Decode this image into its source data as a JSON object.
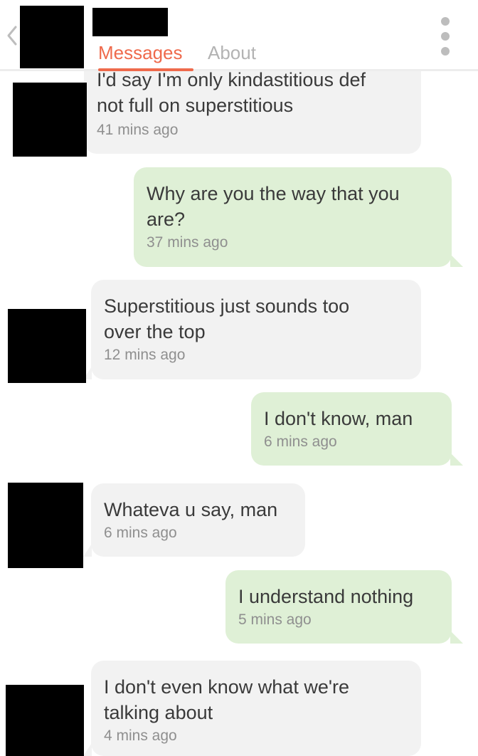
{
  "header": {
    "tabs": [
      {
        "label": "Messages",
        "active": true
      },
      {
        "label": "About",
        "active": false
      }
    ],
    "accent_color": "#ef6a4c"
  },
  "icons": {
    "back": "chevron-left-icon",
    "more": "vertical-dots-icon"
  },
  "colors": {
    "incoming_bubble": "#f2f2f2",
    "outgoing_bubble": "#dff0d6",
    "text": "#3a3a3a",
    "timestamp": "#8f8f8f"
  },
  "messages": [
    {
      "sender": "them",
      "text": "I'd say I'm only kindastitious def\nnot full on superstitious",
      "time": "41 mins ago"
    },
    {
      "sender": "me",
      "text": "Why are you the way that you\nare?",
      "time": "37 mins ago"
    },
    {
      "sender": "them",
      "text": "Superstitious just sounds too\nover the top",
      "time": "12 mins ago"
    },
    {
      "sender": "me",
      "text": "I don't know,  man",
      "time": "6 mins ago"
    },
    {
      "sender": "them",
      "text": "Whateva u say, man",
      "time": "6 mins ago"
    },
    {
      "sender": "me",
      "text": "I understand nothing",
      "time": "5 mins ago"
    },
    {
      "sender": "them",
      "text": "I don't even know what we're\ntalking about",
      "time": "4 mins ago"
    }
  ]
}
